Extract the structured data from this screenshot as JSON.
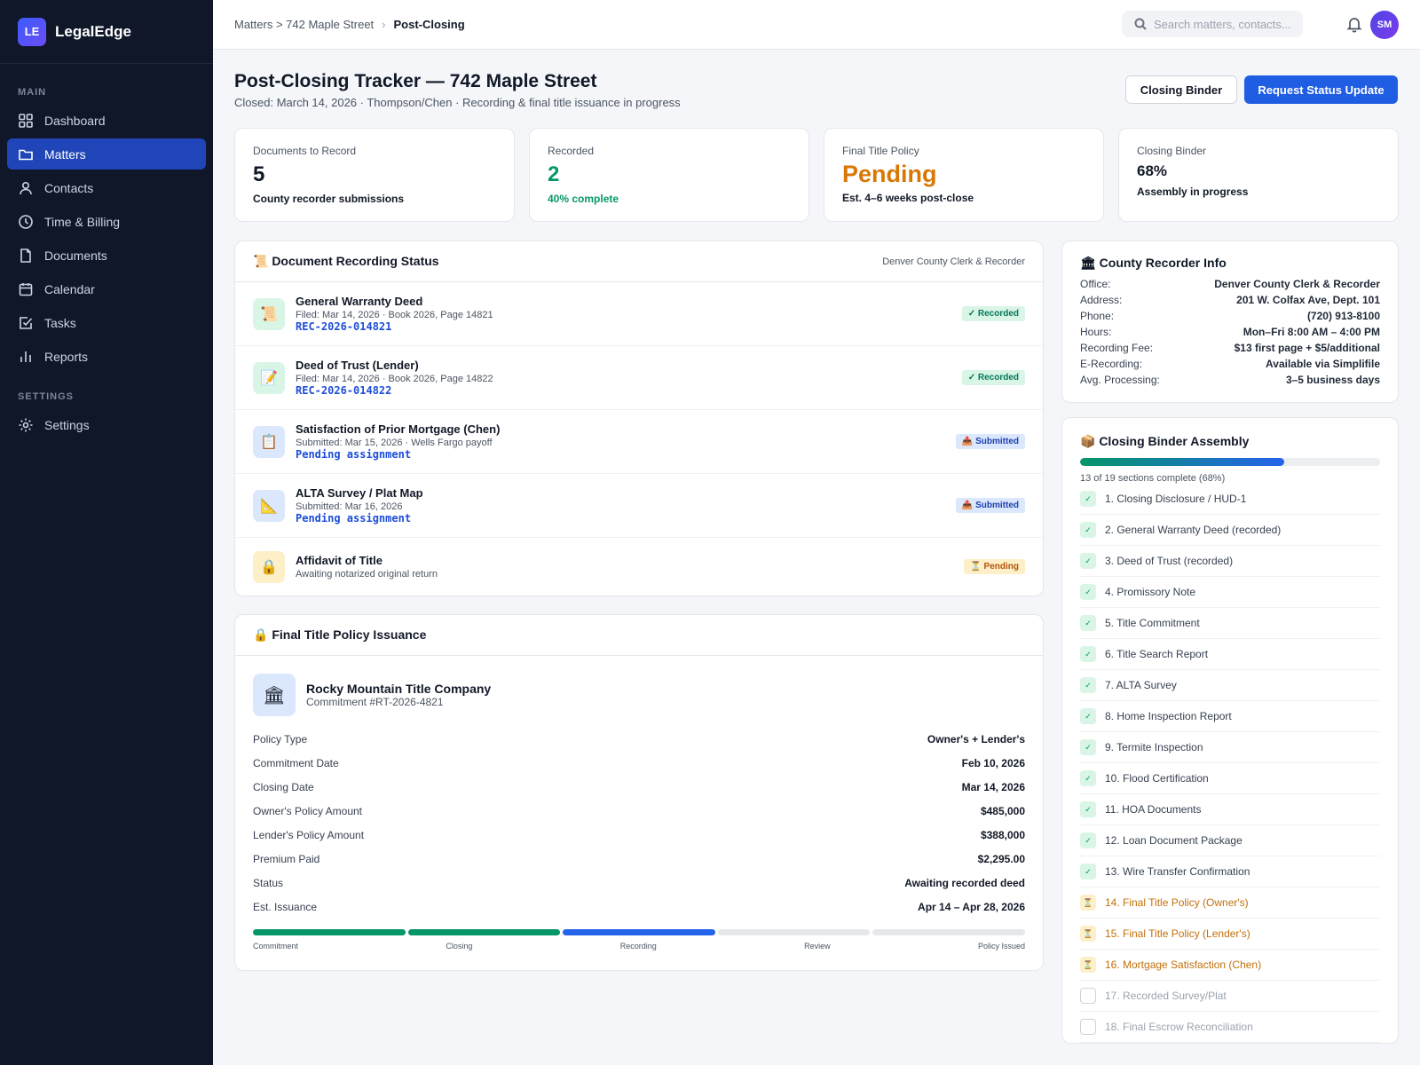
{
  "app": {
    "logo": "LE",
    "name": "LegalEdge"
  },
  "sidebar": {
    "main_label": "MAIN",
    "settings_label": "SETTINGS",
    "items": [
      {
        "label": "Dashboard",
        "icon": "grid-icon"
      },
      {
        "label": "Matters",
        "icon": "folder-icon",
        "active": true
      },
      {
        "label": "Contacts",
        "icon": "user-icon"
      },
      {
        "label": "Time & Billing",
        "icon": "clock-icon"
      },
      {
        "label": "Documents",
        "icon": "file-icon"
      },
      {
        "label": "Calendar",
        "icon": "calendar-icon"
      },
      {
        "label": "Tasks",
        "icon": "check-square-icon"
      },
      {
        "label": "Reports",
        "icon": "bar-chart-icon"
      }
    ],
    "settings_item": {
      "label": "Settings",
      "icon": "gear-icon"
    }
  },
  "topbar": {
    "crumb_1": "Matters > 742 Maple Street",
    "crumb_sep": "›",
    "crumb_2": "Post-Closing",
    "search_placeholder": "Search matters, contacts...",
    "avatar": "SM"
  },
  "header": {
    "title": "Post-Closing Tracker — 742 Maple Street",
    "subtitle": "Closed: March 14, 2026 · Thompson/Chen · Recording & final title issuance in progress",
    "btn_binder": "Closing Binder",
    "btn_request": "Request Status Update"
  },
  "stats": [
    {
      "label": "Documents to Record",
      "value": "5",
      "sub": "County recorder submissions"
    },
    {
      "label": "Recorded",
      "value": "2",
      "sub": "40% complete"
    },
    {
      "label": "Final Title Policy",
      "value": "Pending",
      "sub": "Est. 4–6 weeks post-close"
    },
    {
      "label": "Closing Binder",
      "value": "68%",
      "sub": "Assembly in progress"
    }
  ],
  "recording": {
    "title": "📜 Document Recording Status",
    "office": "Denver County Clerk & Recorder",
    "docs": [
      {
        "icon": "📜",
        "name": "General Warranty Deed",
        "filed": "Filed: Mar 14, 2026 · Book 2026, Page 14821",
        "ref": "REC-2026-014821",
        "status": "✓ Recorded"
      },
      {
        "icon": "📝",
        "name": "Deed of Trust (Lender)",
        "filed": "Filed: Mar 14, 2026 · Book 2026, Page 14822",
        "ref": "REC-2026-014822",
        "status": "✓ Recorded"
      },
      {
        "icon": "📋",
        "name": "Satisfaction of Prior Mortgage (Chen)",
        "filed": "Submitted: Mar 15, 2026 · Wells Fargo payoff",
        "ref": "Pending assignment",
        "status": "📤 Submitted"
      },
      {
        "icon": "📐",
        "name": "ALTA Survey / Plat Map",
        "filed": "Submitted: Mar 16, 2026",
        "ref": "Pending assignment",
        "status": "📤 Submitted"
      },
      {
        "icon": "🔒",
        "name": "Affidavit of Title",
        "filed": "Awaiting notarized original return",
        "status": "⏳ Pending"
      }
    ]
  },
  "title_policy": {
    "title": "🔒 Final Title Policy Issuance",
    "icon": "🏛",
    "company": "Rocky Mountain Title Company",
    "commitment": "Commitment #RT-2026-4821",
    "rows": [
      {
        "k": "Policy Type",
        "v": "Owner's + Lender's"
      },
      {
        "k": "Commitment Date",
        "v": "Feb 10, 2026"
      },
      {
        "k": "Closing Date",
        "v": "Mar 14, 2026"
      },
      {
        "k": "Owner's Policy Amount",
        "v": "$485,000"
      },
      {
        "k": "Lender's Policy Amount",
        "v": "$388,000"
      },
      {
        "k": "Premium Paid",
        "v": "$2,295.00"
      },
      {
        "k": "Status",
        "v": "Awaiting recorded deed"
      },
      {
        "k": "Est. Issuance",
        "v": "Apr 14 – Apr 28, 2026"
      }
    ],
    "stages": [
      "Commitment",
      "Closing",
      "Recording",
      "Review",
      "Policy Issued"
    ],
    "stage_states": [
      "done",
      "done",
      "current",
      "todo",
      "todo"
    ],
    "colors": {
      "done": "#059669",
      "current": "#2563eb",
      "todo": "#e5e7eb"
    }
  },
  "recorder": {
    "title": "🏛 County Recorder Info",
    "rows": [
      {
        "k": "Office:",
        "v": "Denver County Clerk & Recorder"
      },
      {
        "k": "Address:",
        "v": "201 W. Colfax Ave, Dept. 101"
      },
      {
        "k": "Phone:",
        "v": "(720) 913-8100"
      },
      {
        "k": "Hours:",
        "v": "Mon–Fri 8:00 AM – 4:00 PM"
      },
      {
        "k": "Recording Fee:",
        "v": "$13 first page + $5/additional"
      },
      {
        "k": "E-Recording:",
        "v": "Available via Simplifile"
      },
      {
        "k": "Avg. Processing:",
        "v": "3–5 business days"
      }
    ]
  },
  "binder": {
    "title": "📦 Closing Binder Assembly",
    "progress": 0.68,
    "progress_text": "13 of 19 sections complete (68%)",
    "items": [
      {
        "label": "1. Closing Disclosure / HUD-1",
        "state": "done"
      },
      {
        "label": "2. General Warranty Deed (recorded)",
        "state": "done"
      },
      {
        "label": "3. Deed of Trust (recorded)",
        "state": "done"
      },
      {
        "label": "4. Promissory Note",
        "state": "done"
      },
      {
        "label": "5. Title Commitment",
        "state": "done"
      },
      {
        "label": "6. Title Search Report",
        "state": "done"
      },
      {
        "label": "7. ALTA Survey",
        "state": "done"
      },
      {
        "label": "8. Home Inspection Report",
        "state": "done"
      },
      {
        "label": "9. Termite Inspection",
        "state": "done"
      },
      {
        "label": "10. Flood Certification",
        "state": "done"
      },
      {
        "label": "11. HOA Documents",
        "state": "done"
      },
      {
        "label": "12. Loan Document Package",
        "state": "done"
      },
      {
        "label": "13. Wire Transfer Confirmation",
        "state": "done"
      },
      {
        "label": "14. Final Title Policy (Owner's)",
        "state": "pending"
      },
      {
        "label": "15. Final Title Policy (Lender's)",
        "state": "pending"
      },
      {
        "label": "16. Mortgage Satisfaction (Chen)",
        "state": "pending"
      },
      {
        "label": "17. Recorded Survey/Plat",
        "state": "todo"
      },
      {
        "label": "18. Final Escrow Reconciliation",
        "state": "todo"
      }
    ],
    "marks": {
      "done": "✓",
      "pending": "⏳",
      "todo": ""
    }
  }
}
